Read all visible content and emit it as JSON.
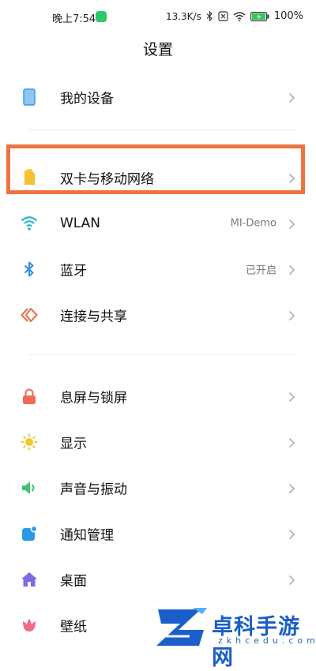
{
  "status_bar": {
    "time": "晚上7:54",
    "speed": "13.3K/s",
    "battery": "100%",
    "battery_level": 1.0
  },
  "header": {
    "title": "设置"
  },
  "groups": [
    {
      "items": [
        {
          "label": "我的设备",
          "value": "",
          "icon": "phone-icon",
          "color": "#4aa3e8"
        }
      ]
    },
    {
      "items": [
        {
          "label": "双卡与移动网络",
          "value": "",
          "icon": "sim-card-icon",
          "color": "#f5c12e"
        },
        {
          "label": "WLAN",
          "value": "MI-Demo",
          "icon": "wifi-icon",
          "color": "#27b3d6"
        },
        {
          "label": "蓝牙",
          "value": "已开启",
          "icon": "bluetooth-icon",
          "color": "#2d8fe0"
        },
        {
          "label": "连接与共享",
          "value": "",
          "icon": "connection-share-icon",
          "color": "#e3764f"
        }
      ]
    },
    {
      "items": [
        {
          "label": "息屏与锁屏",
          "value": "",
          "icon": "lock-icon",
          "color": "#ee6b5b"
        },
        {
          "label": "显示",
          "value": "",
          "icon": "sun-icon",
          "color": "#f4c531"
        },
        {
          "label": "声音与振动",
          "value": "",
          "icon": "speaker-icon",
          "color": "#3dc46d"
        },
        {
          "label": "通知管理",
          "value": "",
          "icon": "notification-icon",
          "color": "#2a9ae6"
        },
        {
          "label": "桌面",
          "value": "",
          "icon": "home-icon",
          "color": "#7b6be0"
        },
        {
          "label": "壁纸",
          "value": "",
          "icon": "flower-icon",
          "color": "#ef6d8a"
        }
      ]
    }
  ],
  "highlight_color": "#ee7341",
  "watermark": {
    "title": "卓科手游网",
    "subtitle": "zkhcedu.com"
  }
}
